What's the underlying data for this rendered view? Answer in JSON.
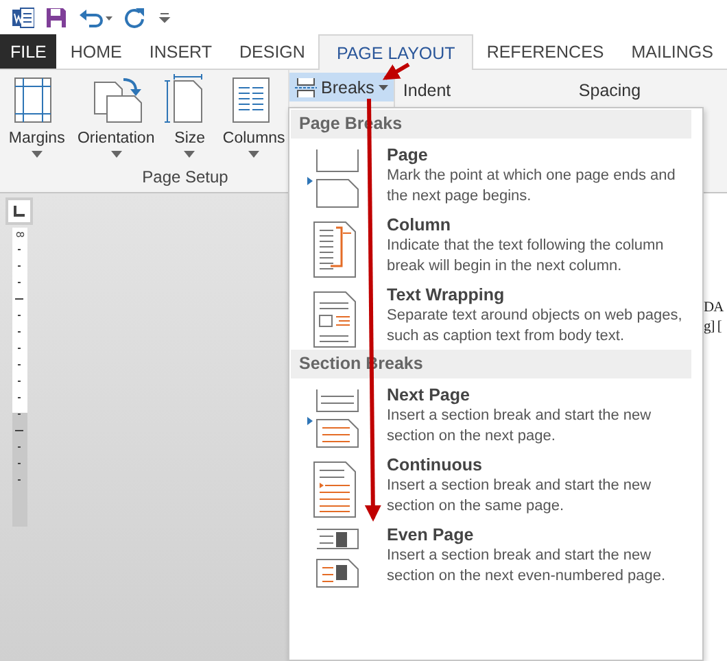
{
  "tabs": [
    {
      "label": "FILE",
      "kind": "file",
      "selected": false
    },
    {
      "label": "HOME",
      "kind": "tab",
      "selected": false
    },
    {
      "label": "INSERT",
      "kind": "tab",
      "selected": false
    },
    {
      "label": "DESIGN",
      "kind": "tab",
      "selected": false
    },
    {
      "label": "PAGE LAYOUT",
      "kind": "tab",
      "selected": true
    },
    {
      "label": "REFERENCES",
      "kind": "tab",
      "selected": false
    },
    {
      "label": "MAILINGS",
      "kind": "tab",
      "selected": false
    }
  ],
  "ribbon": {
    "page_setup": {
      "buttons": [
        {
          "label": "Margins",
          "kind": "margins"
        },
        {
          "label": "Orientation",
          "kind": "orientation"
        },
        {
          "label": "Size",
          "kind": "size"
        },
        {
          "label": "Columns",
          "kind": "columns"
        }
      ],
      "group_label": "Page Setup"
    },
    "breaks_button": {
      "label": "Breaks",
      "expanded": true
    },
    "paragraph_headers": [
      "Indent",
      "Spacing"
    ]
  },
  "ruler": {
    "number": "8"
  },
  "breaks_menu": [
    {
      "title": "Page Breaks",
      "items": [
        {
          "kind": "page",
          "title": "Page",
          "description": "Mark the point at which one page ends and the next page begins."
        },
        {
          "kind": "column",
          "title": "Column",
          "description": "Indicate that the text following the column break will begin in the next column."
        },
        {
          "kind": "wrap",
          "title": "Text Wrapping",
          "description": "Separate text around objects on web pages, such as caption text from body text."
        }
      ]
    },
    {
      "title": "Section Breaks",
      "items": [
        {
          "kind": "next",
          "title": "Next Page",
          "description": "Insert a section break and start the new section on the next page."
        },
        {
          "kind": "continuous",
          "title": "Continuous",
          "description": "Insert a section break and start the new section on the same page."
        },
        {
          "kind": "even",
          "title": "Even Page",
          "description": "Insert a section break and start the new section on the next even-numbered page."
        }
      ]
    }
  ],
  "document_fragments": [
    "DA",
    "g] ["
  ]
}
